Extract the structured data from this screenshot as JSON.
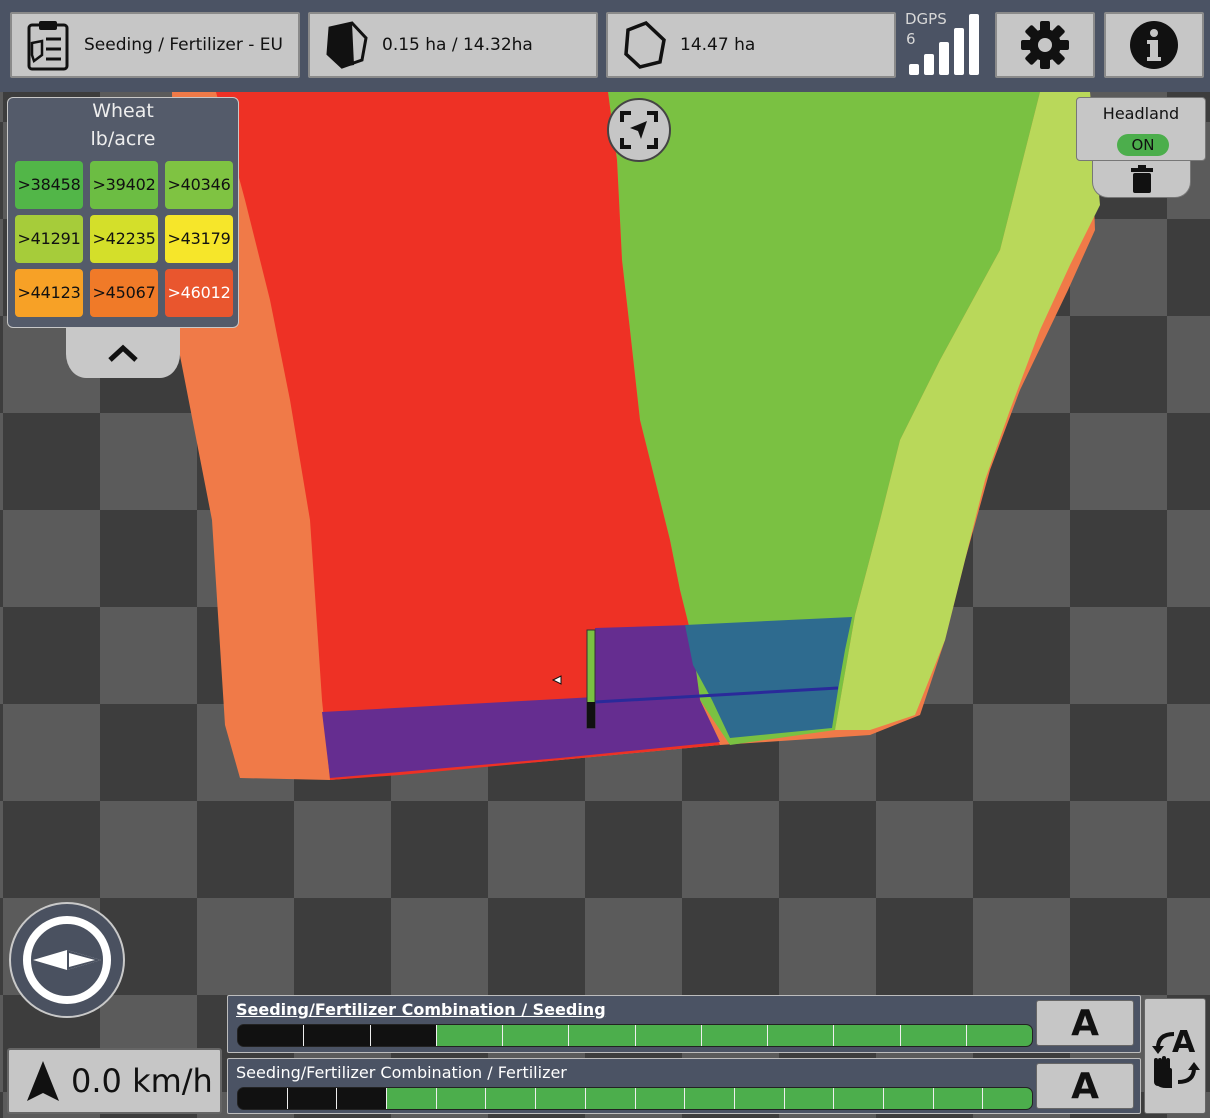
{
  "colors": {
    "topbar": "#4b5364",
    "button_bg": "#c6c6c6",
    "applied_green": "#4cae4c",
    "off_black": "#111111"
  },
  "header": {
    "job_label": "Seeding / Fertilizer - EU",
    "job_icon": "clipboard-icon",
    "worked_area_label": "0.15 ha / 14.32ha",
    "worked_area_icon": "field-worked-icon",
    "field_area_label": "14.47 ha",
    "field_area_icon": "field-outline-icon",
    "gps": {
      "mode": "DGPS",
      "satellites": "6",
      "signal_bars": 5,
      "icon": "signal-bars-icon"
    },
    "settings_icon": "gear-icon",
    "info_icon": "info-icon"
  },
  "legend": {
    "product": "Wheat",
    "unit": "lb/acre",
    "cells": [
      {
        "label": ">38458",
        "color": "#52b648"
      },
      {
        "label": ">39402",
        "color": "#6cbd43"
      },
      {
        "label": ">40346",
        "color": "#7fc342"
      },
      {
        "label": ">41291",
        "color": "#a6cc3a"
      },
      {
        "label": ">42235",
        "color": "#d4df2a"
      },
      {
        "label": ">43179",
        "color": "#f6e62a"
      },
      {
        "label": ">44123",
        "color": "#f7a126"
      },
      {
        "label": ">45067",
        "color": "#f07a28"
      },
      {
        "label": ">46012",
        "color": "#e9562e"
      }
    ],
    "toggle_icon": "chevron-up-icon"
  },
  "map": {
    "center_icon": "recenter-icon"
  },
  "headland": {
    "label": "Headland",
    "state": "ON",
    "delete_icon": "trash-icon"
  },
  "compass": {
    "icon": "compass-icon"
  },
  "speed": {
    "value": "0.0 km/h",
    "icon": "heading-arrow-icon"
  },
  "sections": [
    {
      "title": "Seeding/Fertilizer Combination / Seeding",
      "mode": "A",
      "total_sections": 12,
      "sections_off": 3
    },
    {
      "title": "Seeding/Fertilizer Combination / Fertilizer",
      "mode": "A",
      "total_sections": 16,
      "sections_off": 3
    }
  ],
  "mode_switch": {
    "icon": "auto-manual-switch-icon"
  }
}
